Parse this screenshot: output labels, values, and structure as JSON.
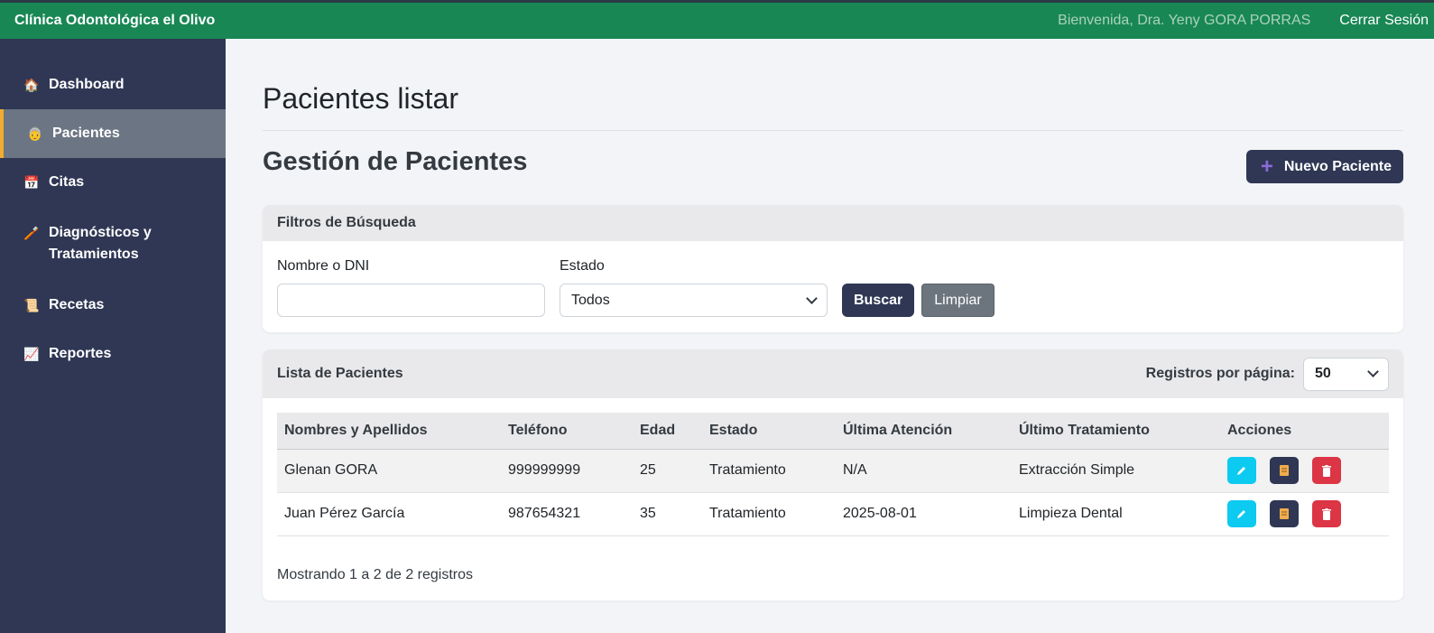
{
  "topbar": {
    "brand": "Clínica Odontológica el Olivo",
    "welcome": "Bienvenida, Dra. Yeny GORA PORRAS",
    "logout": "Cerrar Sesión"
  },
  "sidebar": {
    "items": [
      {
        "icon": "house-icon",
        "glyph": "🏠",
        "label": "Dashboard"
      },
      {
        "icon": "patient-icon",
        "glyph": "👵",
        "label": "Pacientes",
        "active": true
      },
      {
        "icon": "calendar-icon",
        "glyph": "📅",
        "label": "Citas"
      },
      {
        "icon": "toothbrush-icon",
        "glyph": "🪥",
        "label": "Diagnósticos y Tratamientos"
      },
      {
        "icon": "scroll-icon",
        "glyph": "📜",
        "label": "Recetas"
      },
      {
        "icon": "chart-icon",
        "glyph": "📈",
        "label": "Reportes"
      }
    ]
  },
  "main": {
    "page_title": "Pacientes listar",
    "section_title": "Gestión de Pacientes",
    "new_button": "Nuevo Paciente",
    "new_button_icon": "+",
    "filters": {
      "header": "Filtros de Búsqueda",
      "name_label": "Nombre o DNI",
      "name_value": "",
      "status_label": "Estado",
      "status_value": "Todos",
      "search_button": "Buscar",
      "clear_button": "Limpiar"
    },
    "list": {
      "header": "Lista de Pacientes",
      "per_page_label": "Registros por página:",
      "per_page_value": "50",
      "columns": [
        "Nombres y Apellidos",
        "Teléfono",
        "Edad",
        "Estado",
        "Última Atención",
        "Último Tratamiento",
        "Acciones"
      ],
      "rows": [
        [
          "Glenan GORA",
          "999999999",
          "25",
          "Tratamiento",
          "N/A",
          "Extracción Simple"
        ],
        [
          "Juan Pérez García",
          "987654321",
          "35",
          "Tratamiento",
          "2025-08-01",
          "Limpieza Dental"
        ]
      ],
      "footer": "Mostrando 1 a 2 de 2 registros"
    }
  },
  "colors": {
    "topbar": "#198754",
    "sidebar": "#2f3754",
    "active_accent": "#f0ad2e",
    "edit": "#0dcaf0",
    "delete": "#dc3545"
  }
}
